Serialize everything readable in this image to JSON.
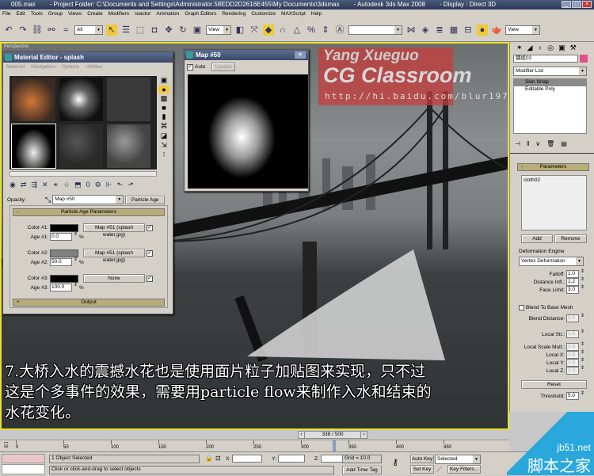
{
  "titlebar": {
    "file": "005.max",
    "project": "- Project Folder: C:\\Documents and Settings\\Administrator.58EDD2D2616E455\\My Documents\\3dsmax",
    "app": "- Autodesk 3ds Max 2008",
    "display": "- Display : Direct 3D"
  },
  "menu": [
    "File",
    "Edit",
    "Tools",
    "Group",
    "Views",
    "Create",
    "Modifiers",
    "reactor",
    "Animation",
    "Graph Editors",
    "Rendering",
    "Customize",
    "MAXScript",
    "Help"
  ],
  "toolbar": {
    "selection_filter": "All",
    "ref_coord": "View",
    "named_sel": "",
    "view2": "View"
  },
  "viewport": {
    "label": "Perspective"
  },
  "watermark": {
    "line1": "Yang Xueguo",
    "line2": "CG Classroom",
    "url": "http://hi.baidu.com/blur1977"
  },
  "material_editor": {
    "title": "Material Editor - splash",
    "menu": [
      "Material",
      "Navigation",
      "Options",
      "Utilities"
    ],
    "opacity_label": "Opacity:",
    "map_name": "Map #50",
    "map_type": "Particle Age",
    "rollout1": "Particle Age Parameters",
    "rollout2": "Output",
    "colors": [
      {
        "label": "Color #1:",
        "age_label": "Age #1:",
        "age": "0.0",
        "map": "Map #51 (splash water.jpg)",
        "swatch": "#000000"
      },
      {
        "label": "Color #2:",
        "age_label": "Age #2:",
        "age": "50.0",
        "map": "Map #51 (splash water.jpg)",
        "swatch": "#808080"
      },
      {
        "label": "Color #3:",
        "age_label": "Age #3:",
        "age": "100.0",
        "map": "None",
        "swatch": "#000000"
      }
    ],
    "pct": "%"
  },
  "map_window": {
    "title": "Map #50",
    "auto": "Auto",
    "update": "Update"
  },
  "command_panel": {
    "object_name": "钢缆02",
    "modifier_list": "Modifier List",
    "stack": [
      "Skin Wrap",
      "Editable Poly"
    ],
    "params_title": "Parameters",
    "list_item": "cloth02",
    "add": "Add",
    "remove": "Remove",
    "engine_label": "Deformation Engine",
    "engine": "Vertex Deformation",
    "falloff_label": "Falloff:",
    "falloff": "1.0",
    "dist_label": "Distance Infl.:",
    "dist": "1.2",
    "face_label": "Face Limit:",
    "face": "3.0",
    "blend_label": "Blend To Base Mesh",
    "blend_dist_label": "Blend Distance:",
    "blend_dist": "5.0",
    "local_str_label": "Local Str.:",
    "local_str": "1.0",
    "local_scale_label": "Local Scale Mult.:",
    "local_scale": "1.0",
    "lx_label": "Local X:",
    "lx": "1.0",
    "ly_label": "Local Y:",
    "ly": "1.0",
    "lz_label": "Local Z:",
    "lz": "1.0",
    "reset": "Reset",
    "thr_label": "Threshold:",
    "thr": "5.0"
  },
  "caption": {
    "line1": "7.大桥入水的震撼水花也是使用面片粒子加贴图来实现，只不过",
    "line2": "这是个多事件的效果，需要用particle flow来制作入水和结束的",
    "line3": "水花变化。"
  },
  "timeline": {
    "frame": "338 / 500",
    "ticks": [
      "0",
      "50",
      "100",
      "150",
      "200",
      "250",
      "300",
      "350",
      "400",
      "450"
    ]
  },
  "status": {
    "selected": "1 Object Selected",
    "prompt": "Click or click-and-drag to select objects",
    "x_label": "X:",
    "y_label": "Y:",
    "z_label": "Z:",
    "grid": "Grid = 10.0",
    "add_time_tag": "Add Time Tag",
    "auto_key": "Auto Key",
    "set_key": "Set Key",
    "selected_dd": "Selected",
    "key_filters": "Key Filters..."
  },
  "site": {
    "domain": "jb51.net",
    "name": "脚本之家"
  }
}
